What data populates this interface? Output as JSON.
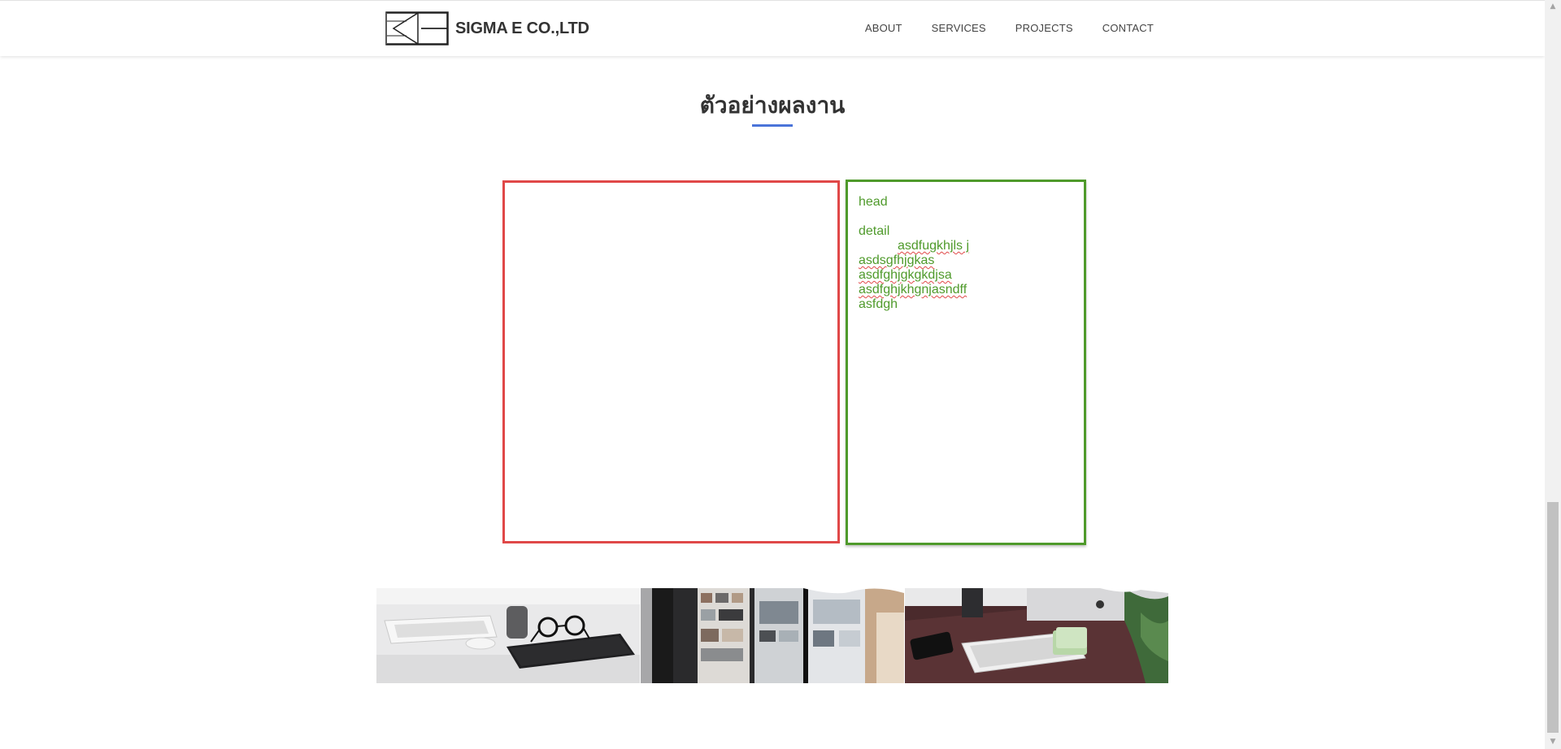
{
  "header": {
    "brand_name": "SIGMA E CO.,LTD",
    "logo_icon": "sigma-logo-icon",
    "nav": [
      {
        "label": "ABOUT"
      },
      {
        "label": "SERVICES"
      },
      {
        "label": "PROJECTS"
      },
      {
        "label": "CONTACT"
      }
    ]
  },
  "section": {
    "title": "ตัวอย่างผลงาน",
    "accent_color": "#4a74d9"
  },
  "card": {
    "head": "head",
    "detail_label": "detail",
    "detail_lines": [
      "asdfugkhjls j",
      "asdsgfhjgkas",
      "asdfghjgkgkdjsa",
      "asdfghjkhgnjasndff",
      "asfdgh"
    ],
    "border_color_left": "#e04848",
    "border_color_right": "#4f9a2b"
  },
  "gallery": {
    "images": [
      {
        "icon": "desk-keyboard-glasses-photo"
      },
      {
        "icon": "monitors-photo"
      },
      {
        "icon": "desk-imac-keyboard-photo"
      }
    ]
  }
}
